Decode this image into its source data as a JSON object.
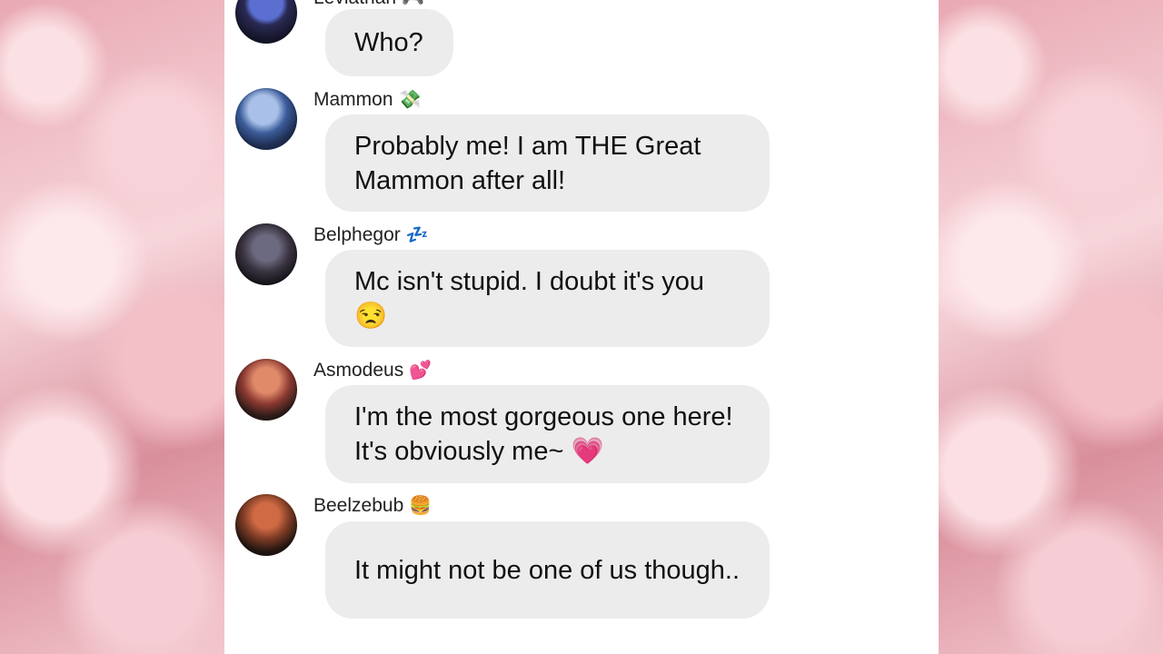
{
  "messages": [
    {
      "name": "Leviathan",
      "name_emoji": "🎮",
      "text": "Who?",
      "avatar_color": "#2a2a55"
    },
    {
      "name": "Mammon",
      "name_emoji": "💸",
      "text": "Probably me! I am THE Great Mammon after all!",
      "avatar_color": "#3b5c9a"
    },
    {
      "name": "Belphegor",
      "name_emoji": "💤",
      "text": "Mc isn't stupid. I doubt it's you 😒",
      "avatar_color": "#3a3340"
    },
    {
      "name": "Asmodeus",
      "name_emoji": "💕",
      "text": "I'm the most gorgeous one here! It's obviously me~ 💗",
      "avatar_color": "#8c3a32"
    },
    {
      "name": "Beelzebub",
      "name_emoji": "🍔",
      "text": "It might not be one of us though..",
      "avatar_color": "#7a3a24"
    }
  ]
}
